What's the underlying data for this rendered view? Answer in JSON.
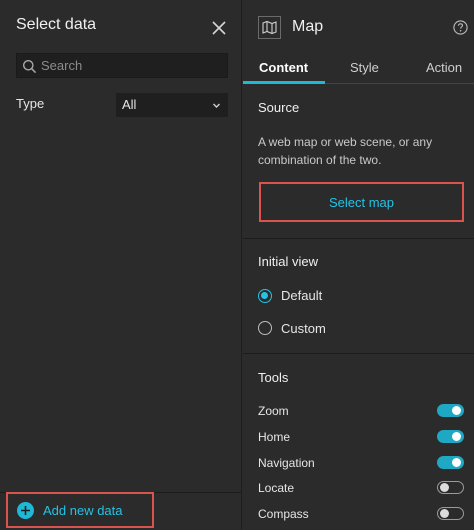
{
  "select_data_panel": {
    "title": "Select data",
    "search": {
      "placeholder": "Search",
      "value": ""
    },
    "type_filter": {
      "label": "Type",
      "selected": "All"
    },
    "add_data_label": "Add new data"
  },
  "map_panel": {
    "title": "Map",
    "tabs": [
      {
        "label": "Content",
        "active": true
      },
      {
        "label": "Style",
        "active": false
      },
      {
        "label": "Action",
        "active": false
      }
    ],
    "source": {
      "title": "Source",
      "description": "A web map or web scene, or any combination of the two.",
      "select_button": "Select map"
    },
    "initial_view": {
      "title": "Initial view",
      "options": [
        {
          "label": "Default",
          "checked": true
        },
        {
          "label": "Custom",
          "checked": false
        }
      ]
    },
    "tools": {
      "title": "Tools",
      "items": [
        {
          "label": "Zoom",
          "enabled": true
        },
        {
          "label": "Home",
          "enabled": true
        },
        {
          "label": "Navigation",
          "enabled": true
        },
        {
          "label": "Locate",
          "enabled": false
        },
        {
          "label": "Compass",
          "enabled": false
        }
      ]
    }
  },
  "colors": {
    "accent": "#22c3e6",
    "highlight_box": "#d9534f",
    "panel_bg": "#2b2b2b"
  }
}
